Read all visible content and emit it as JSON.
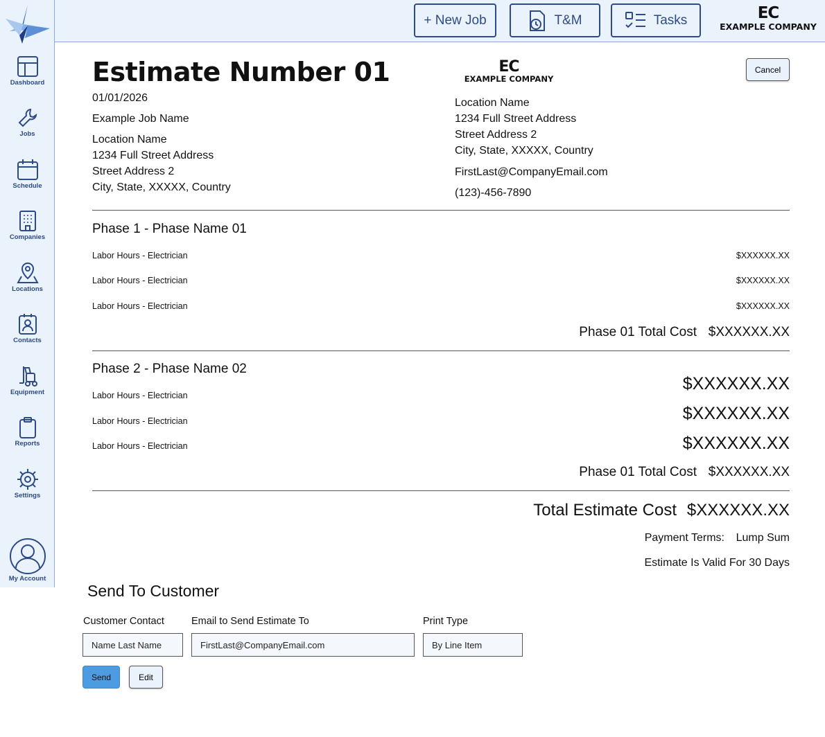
{
  "nav": {
    "dashboard": "Dashboard",
    "jobs": "Jobs",
    "schedule": "Schedule",
    "companies": "Companies",
    "locations": "Locations",
    "contacts": "Contacts",
    "equipment": "Equipment",
    "reports": "Reports",
    "settings": "Settings",
    "account": "My Account"
  },
  "topbar": {
    "new_job": "+ New Job",
    "tm": "T&M",
    "tasks": "Tasks",
    "brand_short": "EC",
    "brand_name": "EXAMPLE COMPANY"
  },
  "estimate": {
    "title": "Estimate Number 01",
    "date": "01/01/2026",
    "job_name": "Example Job Name",
    "customer": {
      "location": "Location Name",
      "address1": "1234 Full Street Address",
      "address2": "Street Address 2",
      "city": "City, State, XXXXX, Country"
    },
    "company": {
      "short": "EC",
      "name": "EXAMPLE COMPANY",
      "location": "Location Name",
      "address1": "1234 Full Street Address",
      "address2": "Street Address 2",
      "city": "City, State, XXXXX, Country",
      "email": "FirstLast@CompanyEmail.com",
      "phone": "(123)-456-7890"
    },
    "cancel": "Cancel",
    "phases": [
      {
        "title": "Phase 1 - Phase Name 01",
        "items": [
          {
            "label": "Labor Hours - Electrician",
            "amount": "$XXXXXX.XX"
          },
          {
            "label": "Labor Hours - Electrician",
            "amount": "$XXXXXX.XX"
          },
          {
            "label": "Labor Hours - Electrician",
            "amount": "$XXXXXX.XX"
          }
        ],
        "total_label": "Phase 01 Total Cost",
        "total_value": "$XXXXXX.XX"
      },
      {
        "title": "Phase 2 - Phase Name 02",
        "items": [
          {
            "label": "Labor Hours - Electrician",
            "amount": "$XXXXXX.XX"
          },
          {
            "label": "Labor Hours - Electrician",
            "amount": "$XXXXXX.XX"
          },
          {
            "label": "Labor Hours - Electrician",
            "amount": "$XXXXXX.XX"
          }
        ],
        "total_label": "Phase 01 Total Cost",
        "total_value": "$XXXXXX.XX"
      }
    ],
    "total_label": "Total Estimate Cost",
    "total_value": "$XXXXXX.XX",
    "payment_terms_label": "Payment Terms:",
    "payment_terms_value": "Lump Sum",
    "validity": "Estimate Is Valid For 30 Days"
  },
  "send": {
    "title": "Send To Customer",
    "contact_label": "Customer Contact",
    "contact_value": "Name Last Name",
    "email_label": "Email to Send Estimate To",
    "email_value": "FirstLast@CompanyEmail.com",
    "print_label": "Print Type",
    "print_value": "By Line Item",
    "send_btn": "Send",
    "edit_btn": "Edit"
  },
  "colors": {
    "navy": "#2e4a85",
    "panel": "#eaf2fc",
    "send_blue": "#4d9be0"
  }
}
